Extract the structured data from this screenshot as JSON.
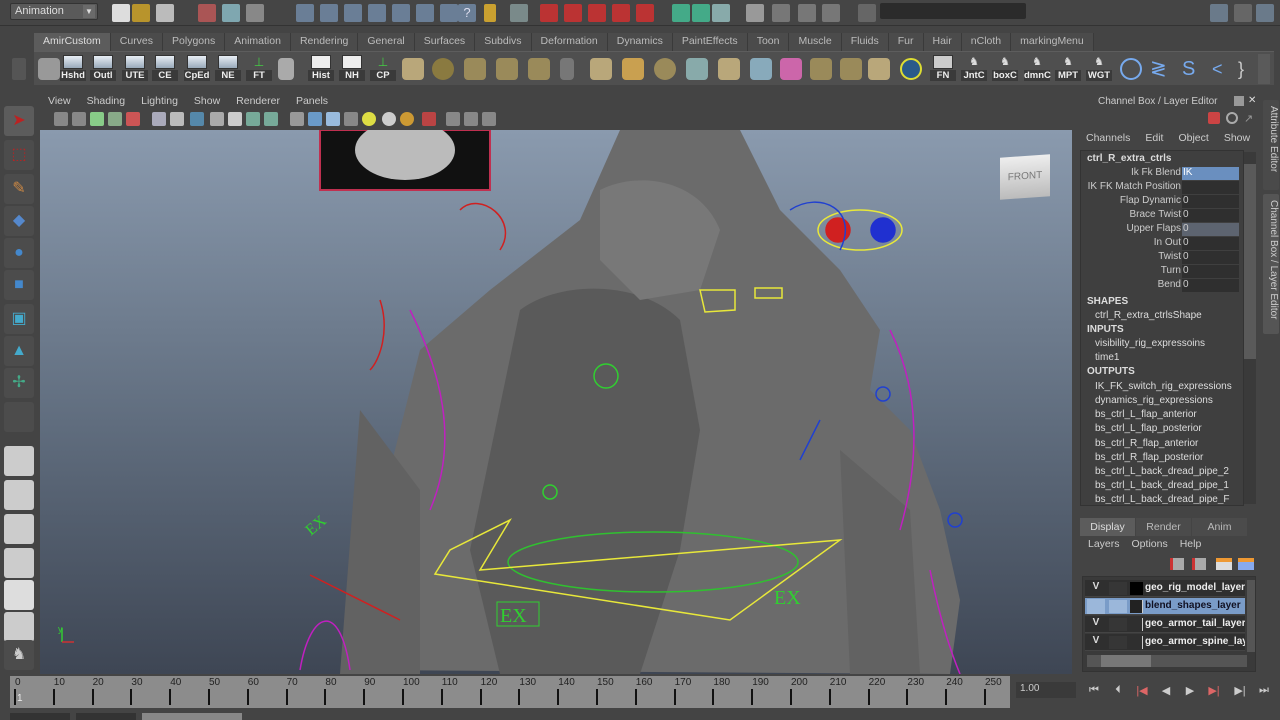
{
  "statusbar": {
    "mode": "Animation",
    "command_line": ""
  },
  "shelf": {
    "tabs": [
      "AmirCustom",
      "Curves",
      "Polygons",
      "Animation",
      "Rendering",
      "General",
      "Surfaces",
      "Subdivs",
      "Deformation",
      "Dynamics",
      "PaintEffects",
      "Toon",
      "Muscle",
      "Fluids",
      "Fur",
      "Hair",
      "nCloth",
      "markingMenu"
    ],
    "active_tab": "AmirCustom",
    "buttons": [
      "Hshd",
      "Outl",
      "UTE",
      "CE",
      "CpEd",
      "NE",
      "FT",
      "Hist",
      "NH",
      "CP",
      "FN",
      "JntC",
      "boxC",
      "dmnC",
      "MPT",
      "WGT"
    ]
  },
  "viewport": {
    "menu": [
      "View",
      "Shading",
      "Lighting",
      "Show",
      "Renderer",
      "Panels"
    ],
    "viewcube": "FRONT",
    "labels": [
      "EX",
      "EX",
      "EX"
    ],
    "axis": "y"
  },
  "channel_box": {
    "title": "Channel Box / Layer Editor",
    "menu": [
      "Channels",
      "Edit",
      "Object",
      "Show"
    ],
    "node": "ctrl_R_extra_ctrls",
    "attributes": [
      {
        "name": "Ik Fk Blend",
        "value": "IK"
      },
      {
        "name": "IK FK Match Position",
        "value": ""
      },
      {
        "name": "Flap Dynamic",
        "value": "0"
      },
      {
        "name": "Brace Twist",
        "value": "0"
      },
      {
        "name": "Upper Flaps",
        "value": "0"
      },
      {
        "name": "In Out",
        "value": "0"
      },
      {
        "name": "Twist",
        "value": "0"
      },
      {
        "name": "Turn",
        "value": "0"
      },
      {
        "name": "Bend",
        "value": "0"
      }
    ],
    "shapes_label": "SHAPES",
    "shapes": [
      "ctrl_R_extra_ctrlsShape"
    ],
    "inputs_label": "INPUTS",
    "inputs": [
      "visibility_rig_expressoins",
      "time1"
    ],
    "outputs_label": "OUTPUTS",
    "outputs": [
      "IK_FK_switch_rig_expressions",
      "dynamics_rig_expressions",
      "bs_ctrl_L_flap_anterior",
      "bs_ctrl_L_flap_posterior",
      "bs_ctrl_R_flap_anterior",
      "bs_ctrl_R_flap_posterior",
      "bs_ctrl_L_back_dread_pipe_2",
      "bs_ctrl_L_back_dread_pipe_1",
      "bs_ctrl_L_back_dread_pipe_F"
    ]
  },
  "side_tabs": [
    "Attribute Editor",
    "Channel Box / Layer Editor"
  ],
  "layer_editor": {
    "tabs": [
      "Display",
      "Render",
      "Anim"
    ],
    "active_tab": "Display",
    "menu": [
      "Layers",
      "Options",
      "Help"
    ],
    "layers": [
      {
        "vis": "V",
        "name": "geo_rig_model_layer",
        "color": "#000000",
        "selected": false
      },
      {
        "vis": "",
        "name": "blend_shapes_layer",
        "color": "#222222",
        "selected": true
      },
      {
        "vis": "V",
        "name": "geo_armor_tail_layer",
        "color": "",
        "selected": false
      },
      {
        "vis": "V",
        "name": "geo_armor_spine_layer",
        "color": "",
        "selected": false
      }
    ]
  },
  "timeline": {
    "ticks": [
      0,
      10,
      20,
      30,
      40,
      50,
      60,
      70,
      80,
      90,
      100,
      110,
      120,
      130,
      140,
      150,
      160,
      170,
      180,
      190,
      200,
      210,
      220,
      230,
      240,
      250
    ],
    "current_frame": "1",
    "current_time": "1.00"
  },
  "playback": [
    "go-to-start",
    "step-back-key",
    "step-back-frame",
    "play-backward",
    "play-forward",
    "step-forward-frame",
    "step-forward-key",
    "go-to-end"
  ],
  "colors": {
    "bg": "#444444",
    "accent": "#6a8fbf",
    "curve_yellow": "#e8e83a",
    "curve_magenta": "#c020c0",
    "curve_red": "#d02020",
    "curve_blue": "#2040d0",
    "curve_green": "#30d030"
  }
}
